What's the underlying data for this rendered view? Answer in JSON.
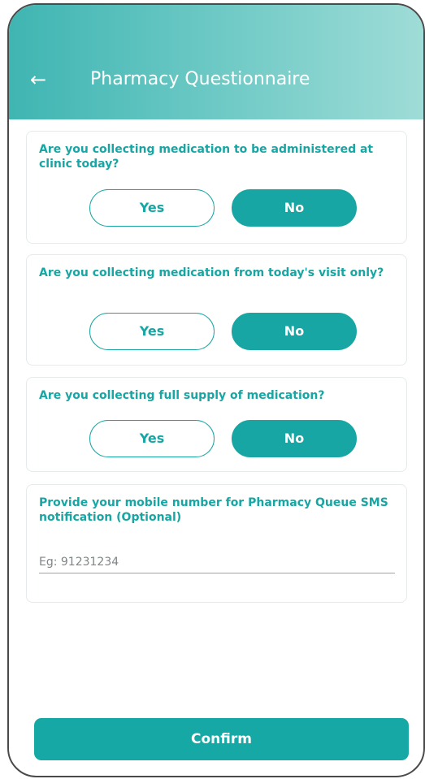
{
  "header": {
    "title": "Pharmacy Questionnaire",
    "back_icon": "arrow-left-icon",
    "back_glyph": "←"
  },
  "questions": [
    {
      "text": "Are you collecting medication to be administered at clinic today?",
      "yes_label": "Yes",
      "no_label": "No",
      "selected": "No"
    },
    {
      "text": "Are you collecting medication from today's visit only?",
      "yes_label": "Yes",
      "no_label": "No",
      "selected": "No"
    },
    {
      "text": "Are you collecting full supply of medication?",
      "yes_label": "Yes",
      "no_label": "No",
      "selected": "No"
    }
  ],
  "mobile": {
    "label": "Provide your mobile number for Pharmacy Queue SMS notification (Optional)",
    "placeholder": "Eg: 91231234",
    "value": ""
  },
  "confirm_label": "Confirm",
  "colors": {
    "accent": "#16a8a5",
    "header_gradient": [
      "#3fb5b2",
      "#9fdcd7"
    ]
  }
}
